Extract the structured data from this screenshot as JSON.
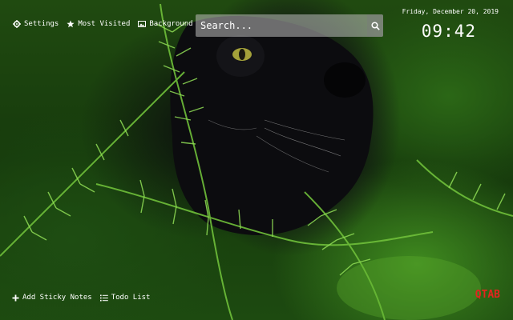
{
  "topbar": {
    "items": [
      {
        "label": "Settings",
        "icon": "gear-icon"
      },
      {
        "label": "Most Visited",
        "icon": "star-icon"
      },
      {
        "label": "Background",
        "icon": "image-icon"
      }
    ]
  },
  "search": {
    "placeholder": "Search...",
    "icon": "search-icon"
  },
  "clock": {
    "date": "Friday, December 20, 2019",
    "time": "09:42"
  },
  "bottombar": {
    "items": [
      {
        "label": "Add Sticky Notes",
        "icon": "plus-icon"
      },
      {
        "label": "Todo List",
        "icon": "list-icon"
      }
    ]
  },
  "brand": {
    "logo": "QTAB",
    "accent": "#e3241f"
  }
}
